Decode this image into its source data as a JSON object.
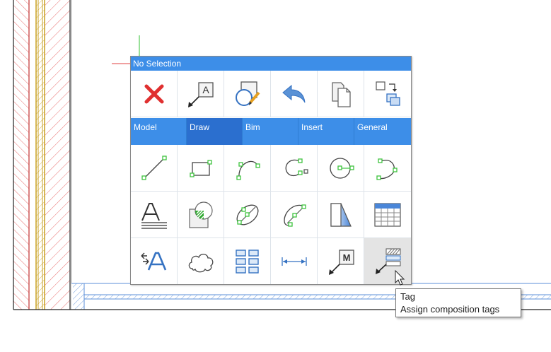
{
  "quad": {
    "header": "No Selection",
    "tabs": [
      {
        "label": "Model",
        "active": false
      },
      {
        "label": "Draw",
        "active": true
      },
      {
        "label": "Bim",
        "active": false
      },
      {
        "label": "Insert",
        "active": false
      },
      {
        "label": "General",
        "active": false
      }
    ],
    "top_row_icons": [
      "delete-x-icon",
      "text-annotation-icon",
      "region-edit-icon",
      "undo-arrow-icon",
      "copy-pages-icon",
      "copy-blocks-icon"
    ],
    "mtext_letter": "A",
    "mleader_letter": "M",
    "draw_icons": [
      [
        "line-icon",
        "rectangle-icon",
        "arc-icon",
        "arc-center-icon",
        "circle-icon",
        "polyline-icon"
      ],
      [
        "text-icon",
        "hatch-icon",
        "ellipse-icon",
        "ellipse-arc-icon",
        "gradient-icon",
        "table-icon"
      ],
      [
        "text-style-icon",
        "revision-cloud-icon",
        "array-icon",
        "dimension-icon",
        "multileader-icon",
        "composition-tag-icon"
      ]
    ]
  },
  "tooltip": {
    "title": "Tag",
    "description": "Assign composition tags"
  },
  "colors": {
    "accent": "#3d8ee8",
    "tab_active": "#2b6fcf",
    "delete": "#e03030",
    "grip": "#3ec43e",
    "hatch": "#e05050",
    "wall_gold": "#c8a020",
    "icon_blue": "#3572c2"
  }
}
